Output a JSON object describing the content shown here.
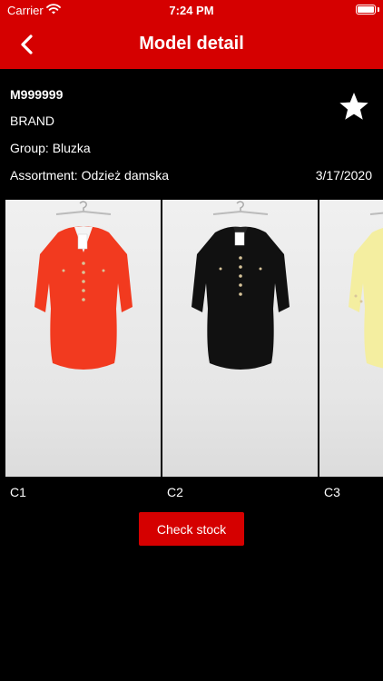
{
  "status_bar": {
    "carrier": "Carrier",
    "time": "7:24 PM"
  },
  "nav": {
    "title": "Model detail",
    "back_icon": "chevron-left-icon"
  },
  "model": {
    "code": "M999999",
    "brand": "BRAND",
    "group": "Group: Bluzka",
    "assortment": "Assortment: Odzież damska",
    "date": "3/17/2020",
    "favorite_icon": "star-icon"
  },
  "colors": [
    {
      "label": "C1",
      "shirt_color": "#f23a1f"
    },
    {
      "label": "C2",
      "shirt_color": "#111111"
    },
    {
      "label": "C3",
      "shirt_color": "#f4eea0"
    }
  ],
  "actions": {
    "check_stock": "Check stock"
  },
  "theme": {
    "accent": "#d50000",
    "background": "#000000"
  }
}
